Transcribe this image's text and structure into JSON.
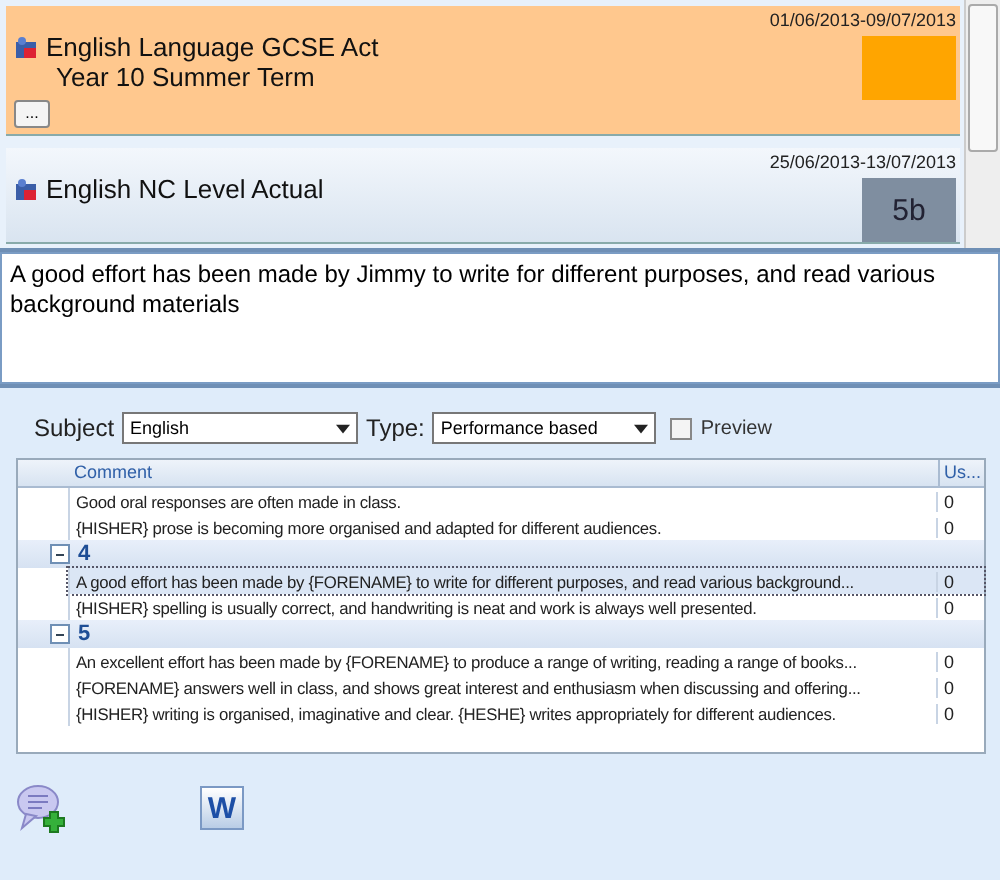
{
  "cards": [
    {
      "date": "01/06/2013-09/07/2013",
      "title": "English Language GCSE Act",
      "subtitle": "Year 10 Summer Term",
      "more": "...",
      "selected": true,
      "swatch": {
        "color": "#ffa500"
      }
    },
    {
      "date": "25/06/2013-13/07/2013",
      "title": "English NC Level Actual",
      "selected": false,
      "swatch": {
        "color": "#7f8ea0",
        "grade": "5b"
      }
    }
  ],
  "report_text": "A good effort has been made by Jimmy to write for different purposes, and read various background materials",
  "filters": {
    "subject_label": "Subject",
    "subject": "English",
    "type_label": "Type:",
    "type": "Performance based",
    "preview": {
      "label": "Preview",
      "checked": false
    }
  },
  "grid": {
    "columns": [
      "Comment",
      "Us..."
    ],
    "groups": [
      {
        "rows": [
          {
            "comment": "Good oral responses are often made in class.",
            "uses": "0",
            "selected": false
          },
          {
            "comment": "{HISHER} prose is becoming more organised and adapted for different audiences.",
            "uses": "0",
            "selected": false
          }
        ]
      },
      {
        "label": "4",
        "expanded": true,
        "rows": [
          {
            "comment": "A good effort has been made by {FORENAME} to write for different purposes, and read various background...",
            "uses": "0",
            "selected": true
          },
          {
            "comment": "{HISHER} spelling is usually correct, and handwriting is neat and work is always well presented.",
            "uses": "0",
            "selected": false
          }
        ]
      },
      {
        "label": "5",
        "expanded": true,
        "rows": [
          {
            "comment": "An excellent effort has been made by {FORENAME} to produce a range of writing, reading a range of books...",
            "uses": "0",
            "selected": false
          },
          {
            "comment": "{FORENAME} answers well in class, and shows great interest and enthusiasm when discussing and offering...",
            "uses": "0",
            "selected": false
          },
          {
            "comment": "{HISHER} writing is organised, imaginative and clear. {HESHE} writes appropriately for different audiences.",
            "uses": "0",
            "selected": false
          }
        ]
      }
    ]
  },
  "toolbar": {
    "word_letter": "W"
  }
}
